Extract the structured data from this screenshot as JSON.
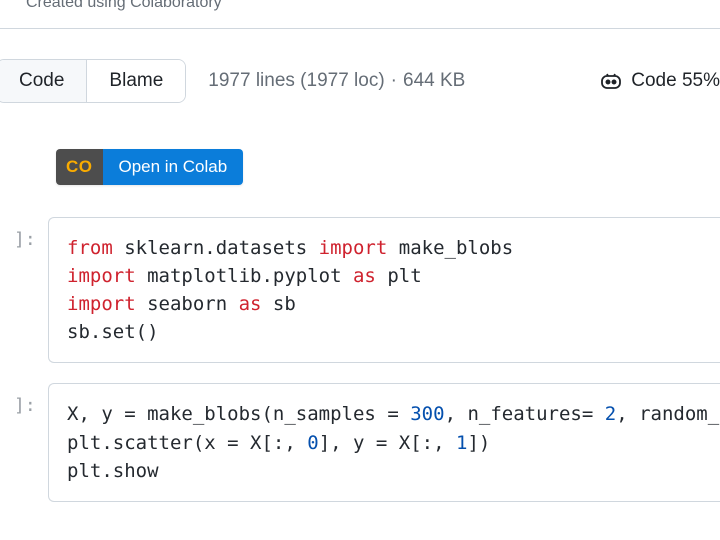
{
  "meta": {
    "created_text": "Created using Colaboratory"
  },
  "toolbar": {
    "code_tab": "Code",
    "blame_tab": "Blame",
    "lines": "1977 lines (1977 loc)",
    "size": "644 KB",
    "dot": "·",
    "code_pct_label": "Code 55%"
  },
  "colab": {
    "logo": "CO",
    "label": "Open in Colab"
  },
  "cells": [
    {
      "prompt": "]:",
      "code_html": "<span class='kw'>from</span> sklearn.datasets <span class='kw'>import</span> make_blobs\n<span class='kw'>import</span> matplotlib.pyplot <span class='kw'>as</span> plt\n<span class='kw'>import</span> seaborn <span class='kw'>as</span> sb\nsb.<span class='id'>set</span>()"
    },
    {
      "prompt": "]:",
      "code_html": "X, y <span class='op'>=</span> make_blobs(n_samples <span class='op'>=</span> <span class='num'>300</span>, n_features<span class='op'>=</span> <span class='num'>2</span>, random_\nplt.scatter(x <span class='op'>=</span> X[:, <span class='num'>0</span>], y <span class='op'>=</span> X[:, <span class='num'>1</span>])\nplt.show"
    }
  ]
}
